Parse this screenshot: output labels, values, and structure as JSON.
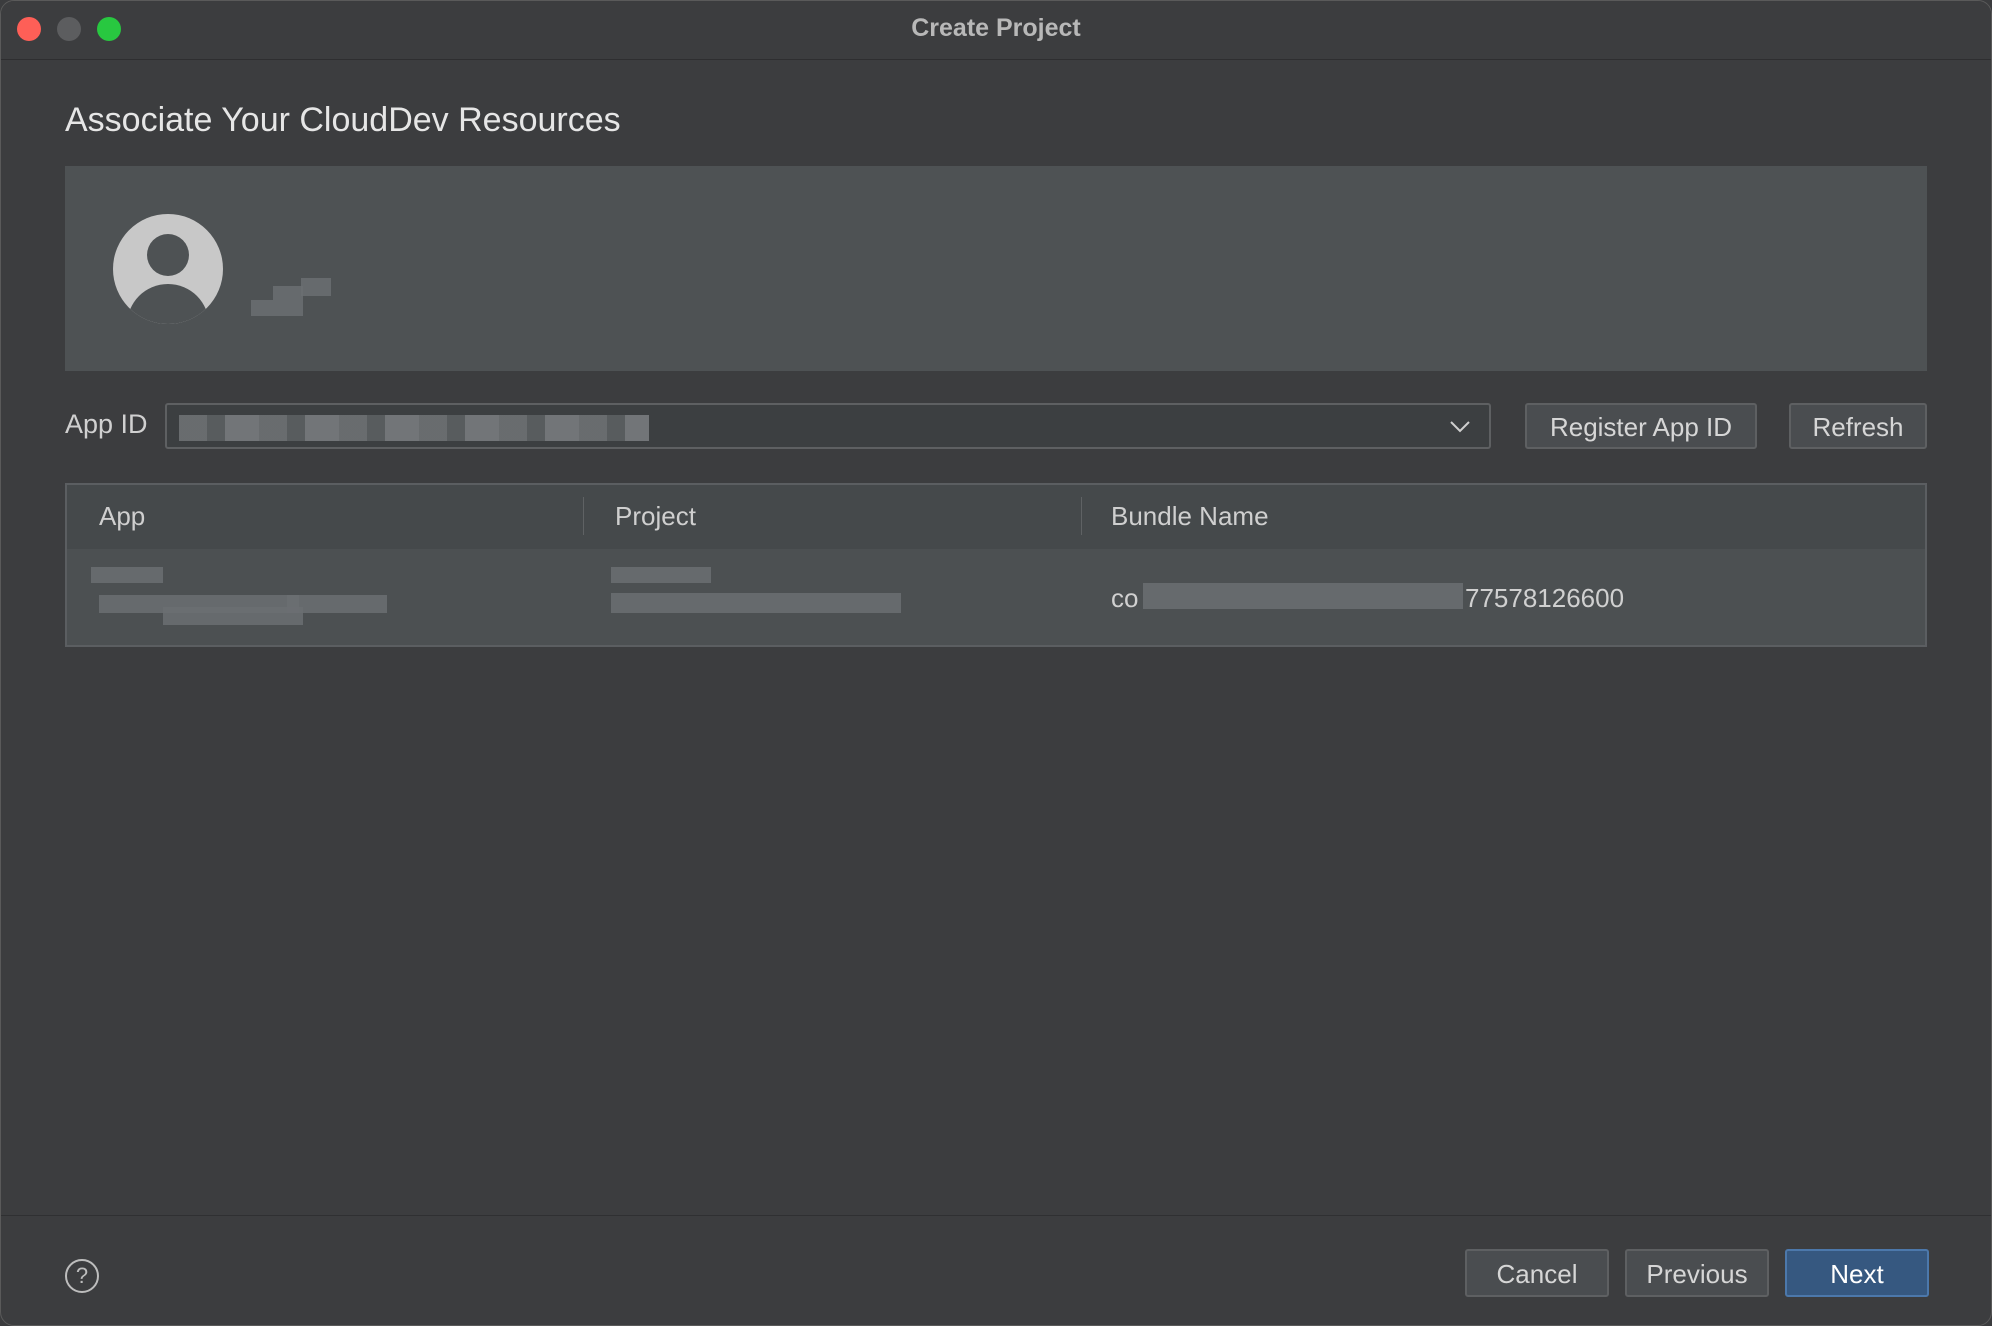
{
  "window": {
    "title": "Create Project"
  },
  "heading": "Associate Your CloudDev Resources",
  "account": {
    "avatar_icon": "user-avatar-icon"
  },
  "app_id": {
    "label": "App ID",
    "selected_value": "",
    "dropdown_icon": "chevron-down-icon"
  },
  "buttons": {
    "register": "Register App ID",
    "refresh": "Refresh",
    "cancel": "Cancel",
    "previous": "Previous",
    "next": "Next"
  },
  "table": {
    "columns": [
      "App",
      "Project",
      "Bundle Name"
    ],
    "rows": [
      {
        "app": "",
        "project": "",
        "bundle_prefix": "co",
        "bundle_suffix": "77578126600"
      }
    ]
  },
  "help_icon": "help-circle-icon",
  "colors": {
    "close": "#fe5f57",
    "maximize": "#28c840",
    "primary_button": "#365880"
  }
}
